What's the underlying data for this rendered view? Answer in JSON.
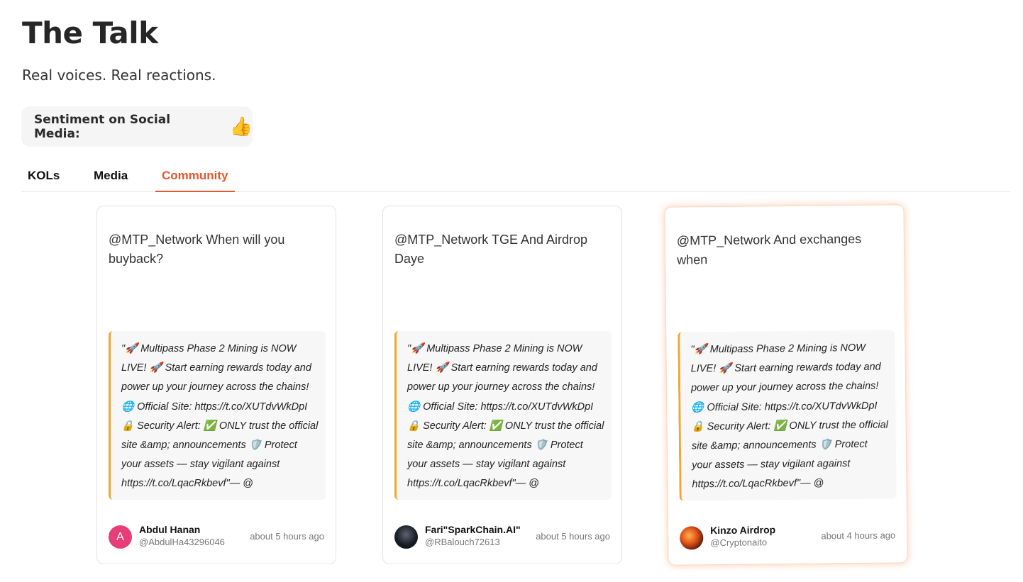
{
  "header": {
    "title": "The Talk",
    "subtitle": "Real voices. Real reactions."
  },
  "sentiment": {
    "label": "Sentiment on Social Media:",
    "icon": "👍",
    "icon_name": "thumbs-up-icon"
  },
  "tabs": [
    {
      "label": "KOLs",
      "active": false
    },
    {
      "label": "Media",
      "active": false
    },
    {
      "label": "Community",
      "active": true
    }
  ],
  "accent_color": "#e4572e",
  "quote_border_color": "#f0a734",
  "posts": [
    {
      "text": "@MTP_Network When will you buyback?",
      "quote": "\"🚀 Multipass Phase 2 Mining is NOW LIVE! 🚀 Start earning rewards today and power up your journey across the chains! 🌐 Official Site: https://t.co/XUTdvWkDpI 🔒 Security Alert: ✅ ONLY trust the official site &amp; announcements 🛡️ Protect your assets — stay vigilant against https://t.co/LqacRkbevf\"— @",
      "author_name": "Abdul Hanan",
      "author_handle": "@AbdulHa43296046",
      "avatar_letter": "A",
      "timestamp": "about 5 hours ago"
    },
    {
      "text": "@MTP_Network TGE And Airdrop Daye",
      "quote": "\"🚀 Multipass Phase 2 Mining is NOW LIVE! 🚀 Start earning rewards today and power up your journey across the chains! 🌐 Official Site: https://t.co/XUTdvWkDpI 🔒 Security Alert: ✅ ONLY trust the official site &amp; announcements 🛡️ Protect your assets — stay vigilant against https://t.co/LqacRkbevf\"— @",
      "author_name": "Fari\"SparkChain.AI\"",
      "author_handle": "@RBalouch72613",
      "avatar_letter": "",
      "timestamp": "about 5 hours ago"
    },
    {
      "text": "@MTP_Network And exchanges when",
      "quote": "\"🚀 Multipass Phase 2 Mining is NOW LIVE! 🚀 Start earning rewards today and power up your journey across the chains! 🌐 Official Site: https://t.co/XUTdvWkDpI 🔒 Security Alert: ✅ ONLY trust the official site &amp; announcements 🛡️ Protect your assets — stay vigilant against https://t.co/LqacRkbevf\"— @",
      "author_name": "Kinzo Airdrop",
      "author_handle": "@Cryptonaito",
      "avatar_letter": "",
      "timestamp": "about 4 hours ago"
    }
  ]
}
